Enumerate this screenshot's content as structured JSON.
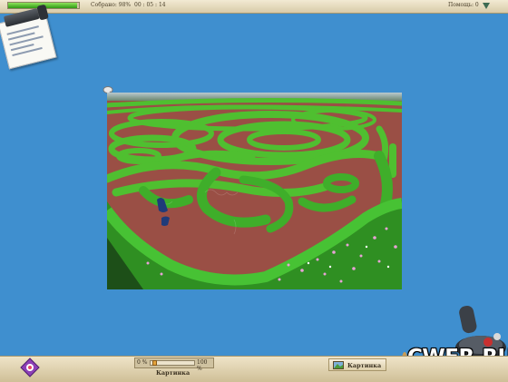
{
  "top_bar": {
    "progress_fraction": 0.98,
    "completion_text": "Собрано: 98%",
    "timer": "00 : 05 : 14",
    "hints_text": "Помощь: 0"
  },
  "bottom_bar": {
    "slider_min": "0 %",
    "slider_max": "100 %",
    "slider_value_fraction": 0.05,
    "caption": "Картинка",
    "picture_button_label": "Картинка"
  },
  "watermark": "CWER.RU",
  "colors": {
    "background": "#3f8fcf",
    "progress_fill": "#3fb01e",
    "hedge": "#3fae2a",
    "path": "#9a4f45"
  },
  "icons": [
    "clipboard-icon",
    "pin-icon",
    "menu-arrow-icon",
    "joystick-icon",
    "app-logo-icon",
    "picture-icon"
  ]
}
